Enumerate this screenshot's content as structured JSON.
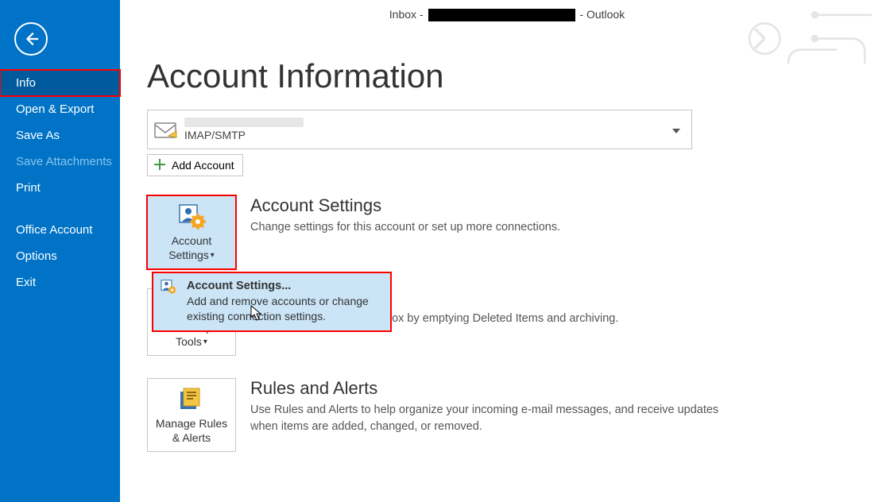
{
  "titlebar": {
    "prefix": "Inbox - ",
    "suffix": " - Outlook"
  },
  "sidebar": {
    "items": [
      {
        "label": "Info",
        "selected": true
      },
      {
        "label": "Open & Export"
      },
      {
        "label": "Save As"
      },
      {
        "label": "Save Attachments",
        "disabled": true
      },
      {
        "label": "Print"
      },
      {
        "label": "Office Account",
        "gapBefore": true
      },
      {
        "label": "Options"
      },
      {
        "label": "Exit"
      }
    ]
  },
  "page": {
    "title": "Account Information",
    "account_type": "IMAP/SMTP",
    "add_account": "Add Account"
  },
  "sections": {
    "accountSettings": {
      "btn": "Account\nSettings",
      "title": "Account Settings",
      "desc": "Change settings for this account or set up more connections."
    },
    "mailbox": {
      "btn": "Cleanup\nTools",
      "desc_tail": "box by emptying Deleted Items and archiving."
    },
    "rules": {
      "btn": "Manage Rules\n& Alerts",
      "title": "Rules and Alerts",
      "desc": "Use Rules and Alerts to help organize your incoming e-mail messages, and receive updates when items are added, changed, or removed."
    }
  },
  "dropdown": {
    "title": "Account Settings...",
    "desc": "Add and remove accounts or change existing connection settings."
  }
}
